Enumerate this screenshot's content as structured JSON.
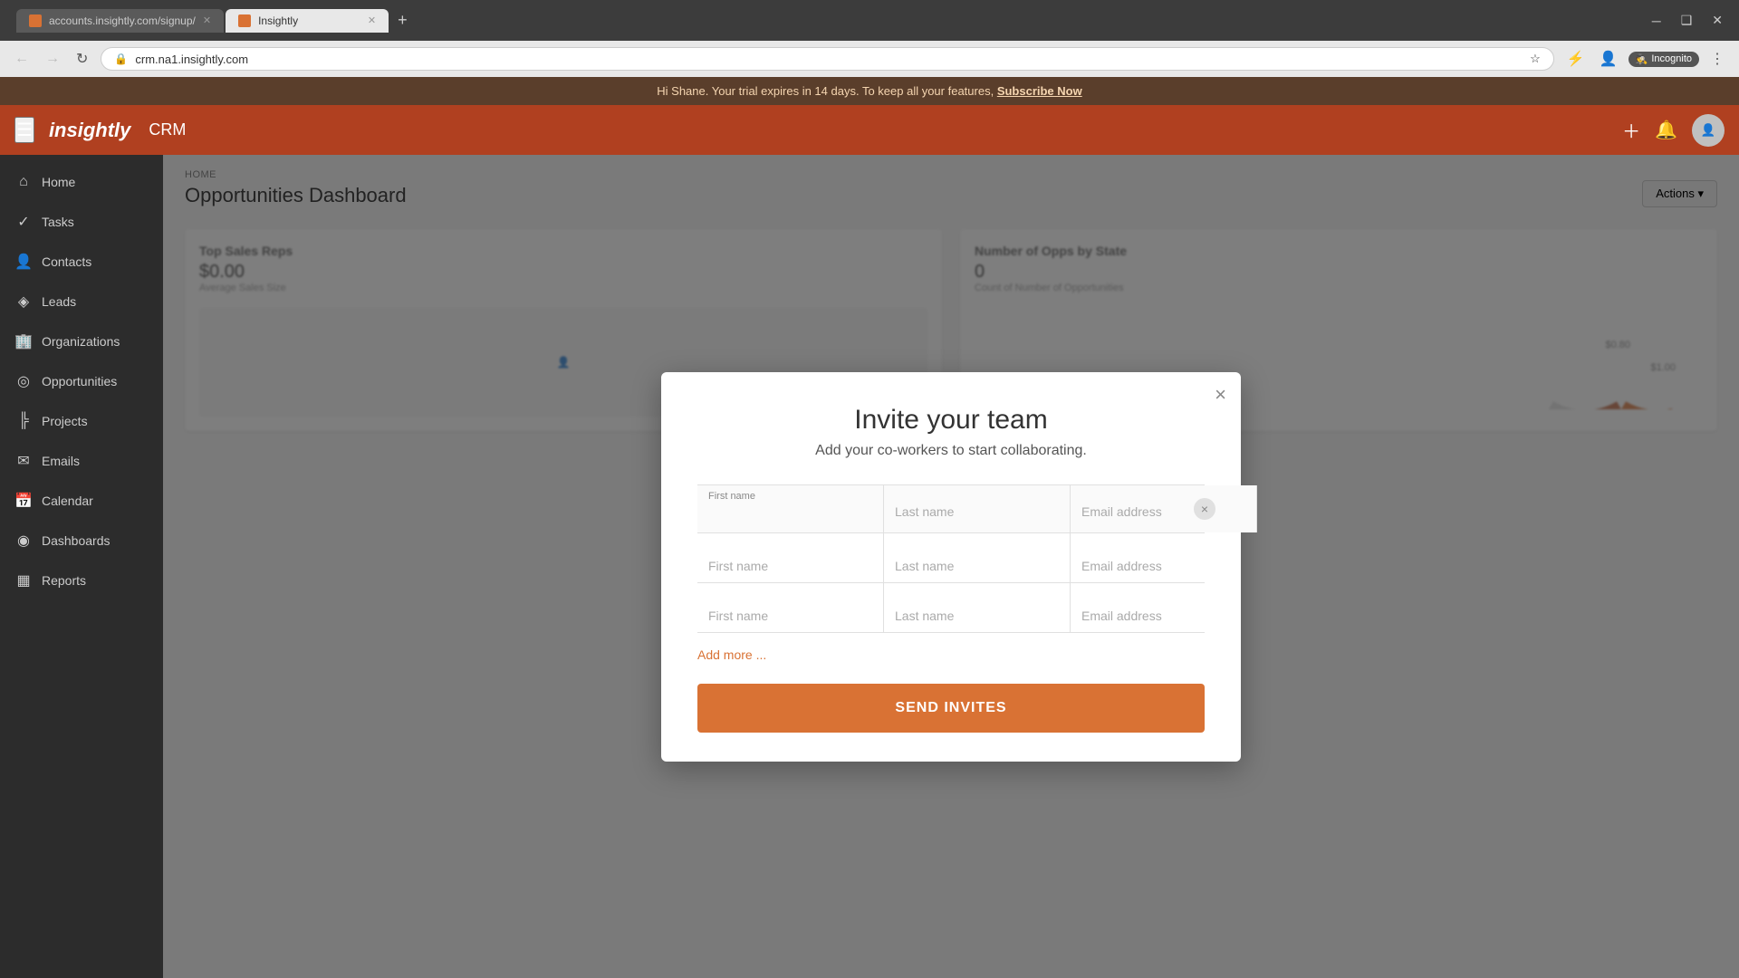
{
  "browser": {
    "tabs": [
      {
        "id": "tab1",
        "favicon": true,
        "label": "accounts.insightly.com/signup/",
        "active": false
      },
      {
        "id": "tab2",
        "favicon": true,
        "label": "Insightly",
        "active": true
      }
    ],
    "add_tab_label": "+",
    "url": "crm.na1.insightly.com",
    "incognito_label": "Incognito",
    "win_minimize": "─",
    "win_maximize": "❑",
    "win_close": "✕"
  },
  "banner": {
    "text": "Hi Shane. Your trial expires in 14 days. To keep all your features,",
    "cta": "Subscribe Now"
  },
  "header": {
    "logo": "insightly",
    "crm": "CRM",
    "hamburger": "☰"
  },
  "sidebar": {
    "items": [
      {
        "id": "home",
        "icon": "⌂",
        "label": "Home"
      },
      {
        "id": "tasks",
        "icon": "✓",
        "label": "Tasks"
      },
      {
        "id": "contacts",
        "icon": "👤",
        "label": "Contacts"
      },
      {
        "id": "leads",
        "icon": "◈",
        "label": "Leads"
      },
      {
        "id": "organizations",
        "icon": "🏢",
        "label": "Organizations"
      },
      {
        "id": "opportunities",
        "icon": "◎",
        "label": "Opportunities"
      },
      {
        "id": "projects",
        "icon": "╠",
        "label": "Projects"
      },
      {
        "id": "emails",
        "icon": "✉",
        "label": "Emails"
      },
      {
        "id": "calendar",
        "icon": "📅",
        "label": "Calendar"
      },
      {
        "id": "dashboards",
        "icon": "◉",
        "label": "Dashboards"
      },
      {
        "id": "reports",
        "icon": "▦",
        "label": "Reports"
      }
    ]
  },
  "page": {
    "breadcrumb": "HOME",
    "title": "Opportunities Dashboard",
    "actions_label": "Actions ▾"
  },
  "dashboard": {
    "top_sales_reps_title": "Top Sales Reps",
    "top_sales_amount": "$0.00",
    "top_sales_sub": "Average Sales Size",
    "opps_by_state_title": "Number of Opps by State",
    "opps_count": "0",
    "opps_sub": "Count of Number of Opportunities"
  },
  "modal": {
    "close_icon": "×",
    "title": "Invite your team",
    "subtitle": "Add your co-workers to start collaborating.",
    "row1": {
      "label": "First name",
      "first_placeholder": "",
      "last_placeholder": "Last name",
      "email_placeholder": "Email address"
    },
    "row2": {
      "first_placeholder": "First name",
      "last_placeholder": "Last name",
      "email_placeholder": "Email address"
    },
    "row3": {
      "first_placeholder": "First name",
      "last_placeholder": "Last name",
      "email_placeholder": "Email address"
    },
    "add_more_label": "Add more ...",
    "send_button_label": "SEND INVITES"
  }
}
